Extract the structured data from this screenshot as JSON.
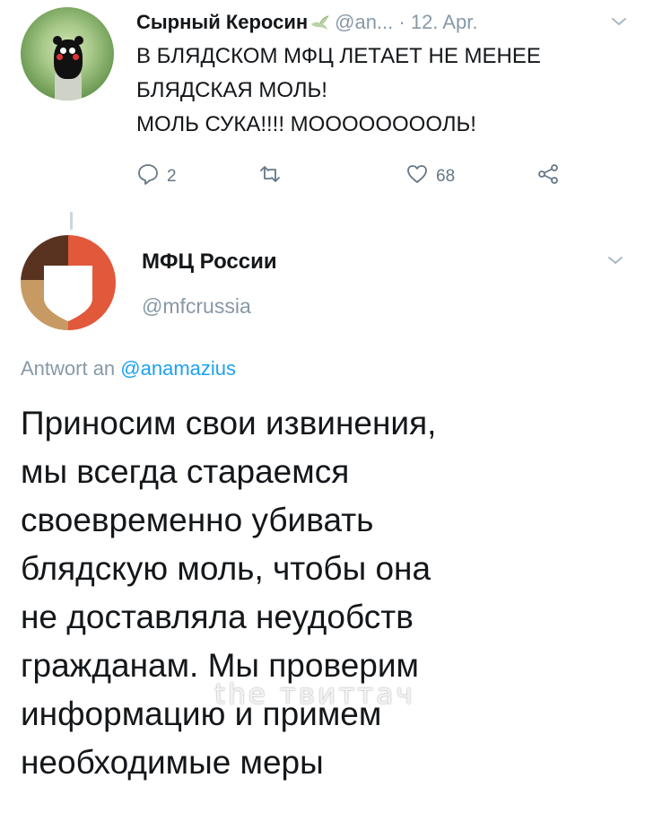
{
  "tweet": {
    "author_name": "Сырный Керосин",
    "author_handle": "@an...",
    "date": "· 12. Apr.",
    "text": "В БЛЯДСКОМ МФЦ ЛЕТАЕТ НЕ МЕНЕЕ\nБЛЯДСКАЯ МОЛЬ!\nМОЛЬ СУКА!!!! МООООООООЛЬ!",
    "actions": {
      "reply_count": "2",
      "retweet_count": "",
      "like_count": "68"
    },
    "icons": {
      "badge": "dove-icon",
      "more": "chevron-down-icon",
      "reply": "reply-bubble-icon",
      "retweet": "retweet-icon",
      "like": "heart-icon",
      "share": "share-icon"
    }
  },
  "reply": {
    "author_name": "МФЦ России",
    "author_handle": "@mfcrussia",
    "reply_to_prefix": "Antwort an",
    "reply_to_mention": "@anamazius",
    "text": "Приносим свои извинения,\nмы всегда стараемся\nсвоевременно убивать\nблядскую моль, чтобы она\nне доставляла неудобств\nгражданам. Мы проверим\nинформацию и примем\nнеобходимые меры"
  },
  "watermark": "the твиттач",
  "colors": {
    "text": "#14171a",
    "muted": "#8899a6",
    "link": "#1da1f2",
    "icon": "#657786",
    "logo_brown": "#5a3320",
    "logo_tan": "#c79a63",
    "logo_red": "#e2583a"
  }
}
